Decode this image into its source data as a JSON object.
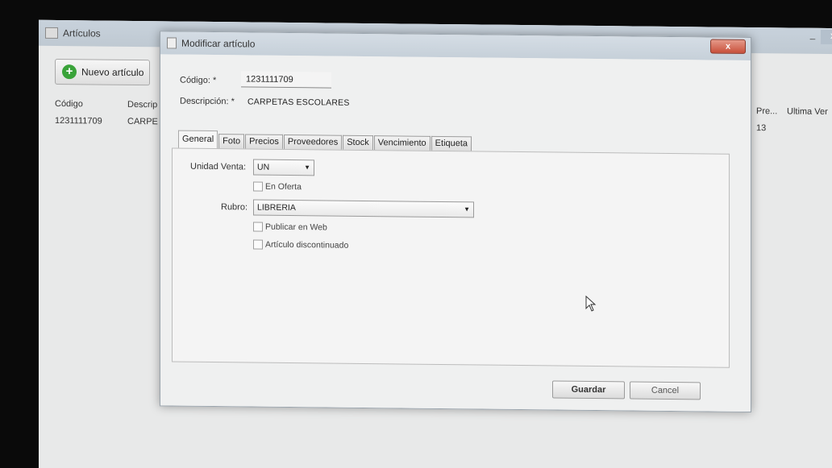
{
  "background_window": {
    "title": "Artículos",
    "new_button_label": "Nuevo artículo",
    "columns": {
      "code": "Código",
      "desc": "Descrip",
      "pre": "Pre...",
      "last": "Ultima Ver"
    },
    "row": {
      "code": "1231111709",
      "desc": "CARPE",
      "pre": "13"
    }
  },
  "modal": {
    "title": "Modificar artículo",
    "close_label": "x",
    "code_label": "Código: *",
    "code_value": "1231111709",
    "desc_label": "Descripción: *",
    "desc_value": "CARPETAS ESCOLARES",
    "tabs": [
      {
        "label": "General"
      },
      {
        "label": "Foto"
      },
      {
        "label": "Precios"
      },
      {
        "label": "Proveedores"
      },
      {
        "label": "Stock"
      },
      {
        "label": "Vencimiento"
      },
      {
        "label": "Etiqueta"
      }
    ],
    "general": {
      "unidad_label": "Unidad Venta:",
      "unidad_value": "UN",
      "oferta_label": "En Oferta",
      "rubro_label": "Rubro:",
      "rubro_value": "LIBRERIA",
      "web_label": "Publicar en Web",
      "discontinued_label": "Artículo discontinuado"
    },
    "save_label": "Guardar",
    "cancel_label": "Cancel"
  },
  "colors": {
    "titlebar": "#c6d0d9",
    "close_button": "#c8503b",
    "add_icon": "#3aa33a"
  }
}
